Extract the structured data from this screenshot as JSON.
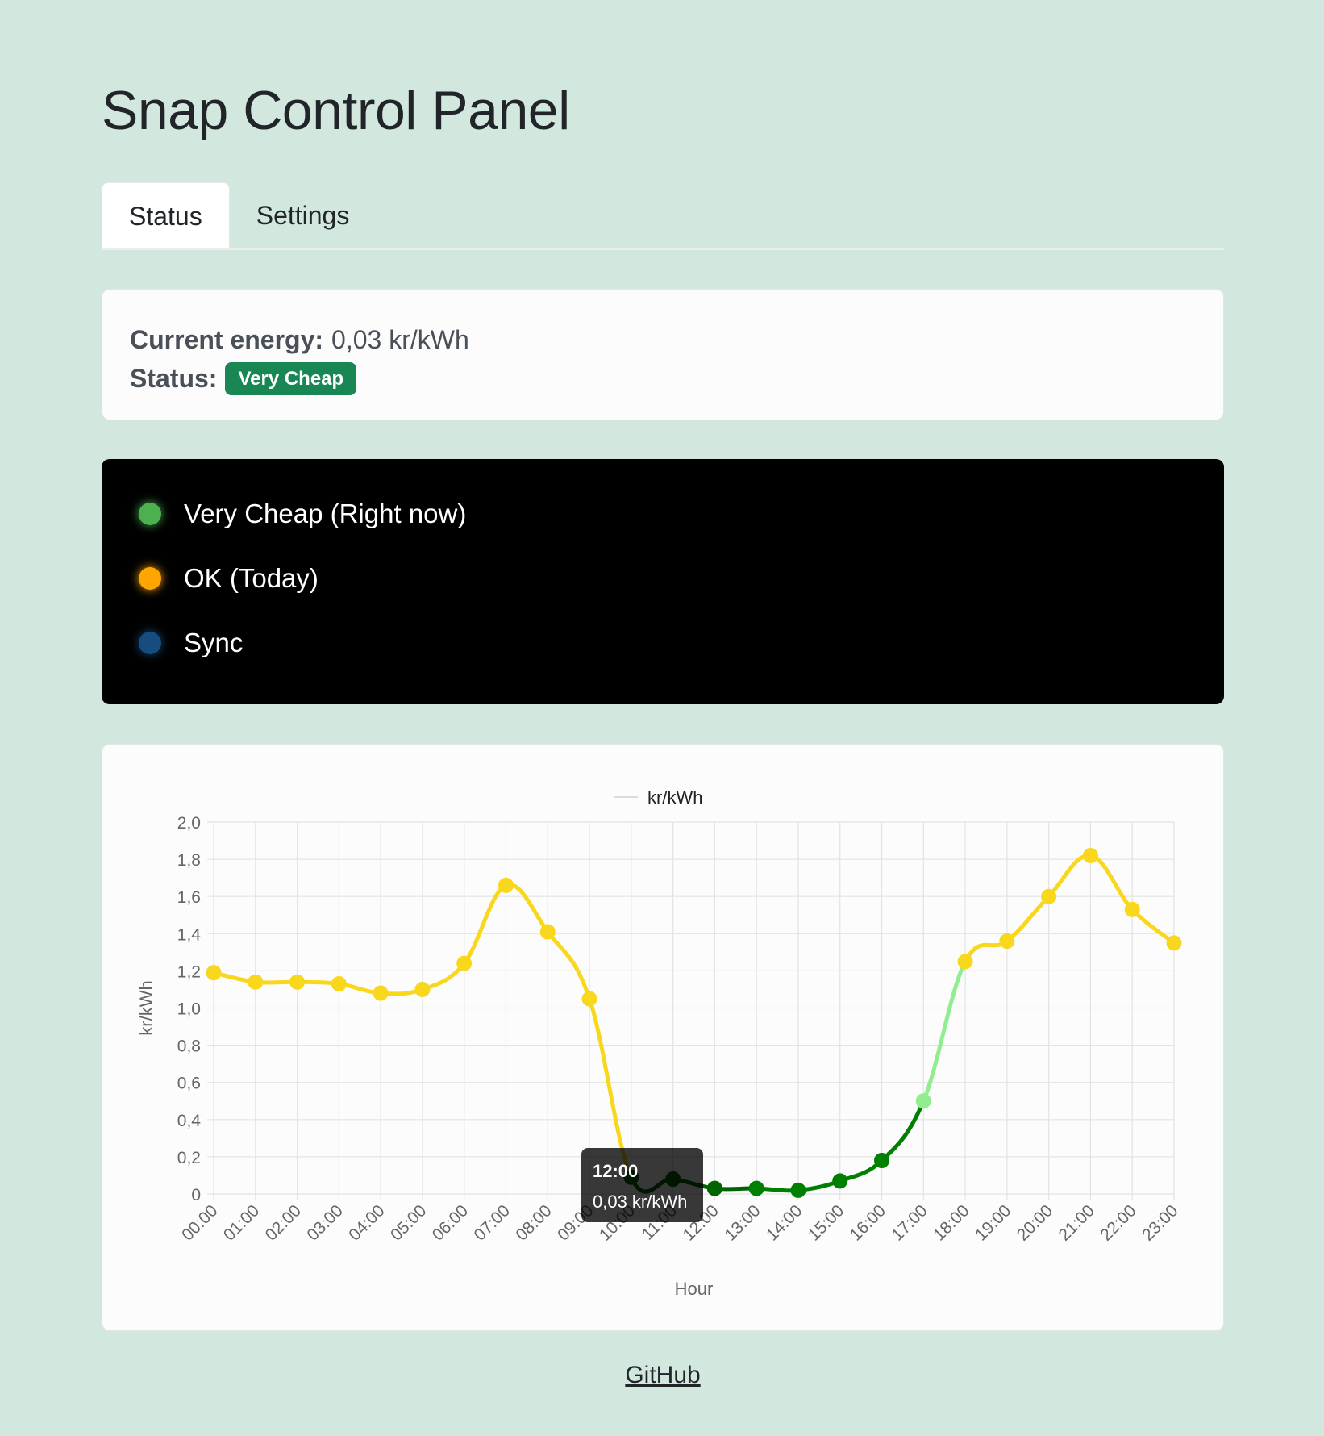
{
  "page": {
    "title": "Snap Control Panel"
  },
  "tabs": [
    {
      "label": "Status",
      "active": true
    },
    {
      "label": "Settings",
      "active": false
    }
  ],
  "info": {
    "energy_label": "Current energy:",
    "energy_value": "0,03 kr/kWh",
    "status_label": "Status:",
    "status_badge": "Very Cheap",
    "status_color": "#198754"
  },
  "leds": [
    {
      "label": "Very Cheap (Right now)",
      "color": "#4caf50"
    },
    {
      "label": "OK (Today)",
      "color": "#ffa500"
    },
    {
      "label": "Sync",
      "color": "#164c7e"
    }
  ],
  "chart_data": {
    "type": "line",
    "legend": "kr/kWh",
    "xlabel": "Hour",
    "ylabel": "kr/kWh",
    "ylim": [
      0,
      2
    ],
    "ytick_labels": [
      "0",
      "0,2",
      "0,4",
      "0,6",
      "0,8",
      "1,0",
      "1,2",
      "1,4",
      "1,6",
      "1,8",
      "2,0"
    ],
    "categories": [
      "00:00",
      "01:00",
      "02:00",
      "03:00",
      "04:00",
      "05:00",
      "06:00",
      "07:00",
      "08:00",
      "09:00",
      "10:00",
      "11:00",
      "12:00",
      "13:00",
      "14:00",
      "15:00",
      "16:00",
      "17:00",
      "18:00",
      "19:00",
      "20:00",
      "21:00",
      "22:00",
      "23:00"
    ],
    "values": [
      1.19,
      1.14,
      1.14,
      1.13,
      1.08,
      1.1,
      1.24,
      1.66,
      1.41,
      1.05,
      0.09,
      0.08,
      0.03,
      0.03,
      0.02,
      0.07,
      0.18,
      0.5,
      1.25,
      1.36,
      1.6,
      1.82,
      1.53,
      1.35
    ],
    "point_colors": [
      "#f9d71c",
      "#f9d71c",
      "#f9d71c",
      "#f9d71c",
      "#f9d71c",
      "#f9d71c",
      "#f9d71c",
      "#f9d71c",
      "#f9d71c",
      "#f9d71c",
      "#006400",
      "#006400",
      "#006400",
      "#008000",
      "#008000",
      "#008000",
      "#008000",
      "#90ee90",
      "#f9d71c",
      "#f9d71c",
      "#f9d71c",
      "#f9d71c",
      "#f9d71c",
      "#f9d71c"
    ],
    "grid": true,
    "legend_position": "top",
    "tooltip": {
      "title": "12:00",
      "body": "0,03 kr/kWh",
      "index": 12
    }
  },
  "footer": {
    "link": "GitHub"
  }
}
